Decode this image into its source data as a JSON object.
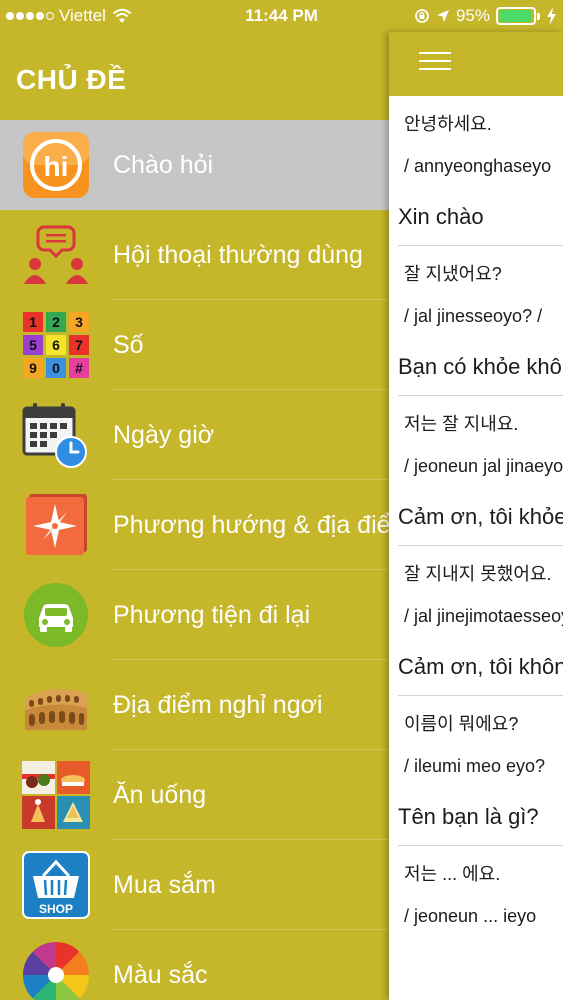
{
  "status_bar": {
    "carrier": "Viettel",
    "time": "11:44 PM",
    "battery_percent": "95%",
    "battery_level": 0.95,
    "battery_color": "#4cd964"
  },
  "sidebar": {
    "title": "CHỦ ĐỀ",
    "items": [
      {
        "label": "Chào hỏi",
        "icon": "hi-greeting-icon",
        "active": true
      },
      {
        "label": "Hội thoại thường dùng",
        "icon": "conversation-people-icon"
      },
      {
        "label": "Số",
        "icon": "number-keypad-icon"
      },
      {
        "label": "Ngày giờ",
        "icon": "calendar-clock-icon"
      },
      {
        "label": "Phương hướng & địa điểm",
        "icon": "compass-icon"
      },
      {
        "label": "Phương tiện đi lại",
        "icon": "car-icon"
      },
      {
        "label": "Địa điểm nghỉ ngơi",
        "icon": "colosseum-icon"
      },
      {
        "label": "Ăn uống",
        "icon": "food-icon"
      },
      {
        "label": "Mua sắm",
        "icon": "shopping-basket-icon"
      },
      {
        "label": "Màu sắc",
        "icon": "color-wheel-icon"
      }
    ]
  },
  "panel": {
    "menu_icon": "hamburger-menu-icon",
    "phrases": [
      {
        "korean": "안녕하세요.",
        "roman": "/ annyeonghaseyo",
        "viet": "Xin chào"
      },
      {
        "korean": "잘 지냈어요?",
        "roman": "/ jal jinesseoyo? /",
        "viet": "Bạn có khỏe không?"
      },
      {
        "korean": "저는 잘 지내요.",
        "roman": "/ jeoneun jal jinaeyo",
        "viet": "Cảm ơn, tôi khỏe"
      },
      {
        "korean": "잘 지내지 못했어요.",
        "roman": "/ jal jinejimotaesseoyo",
        "viet": "Cảm ơn, tôi không khỏe"
      },
      {
        "korean": "이름이 뭐에요?",
        "roman": "/ ileumi meo eyo?",
        "viet": "Tên bạn là gì?"
      },
      {
        "korean": "저는 ... 에요.",
        "roman": "/ jeoneun ... ieyo",
        "viet": ""
      }
    ]
  },
  "colors": {
    "theme_olive": "#c5b62a",
    "active_item": "#c6c6c6",
    "panel_bg": "#ffffff"
  }
}
